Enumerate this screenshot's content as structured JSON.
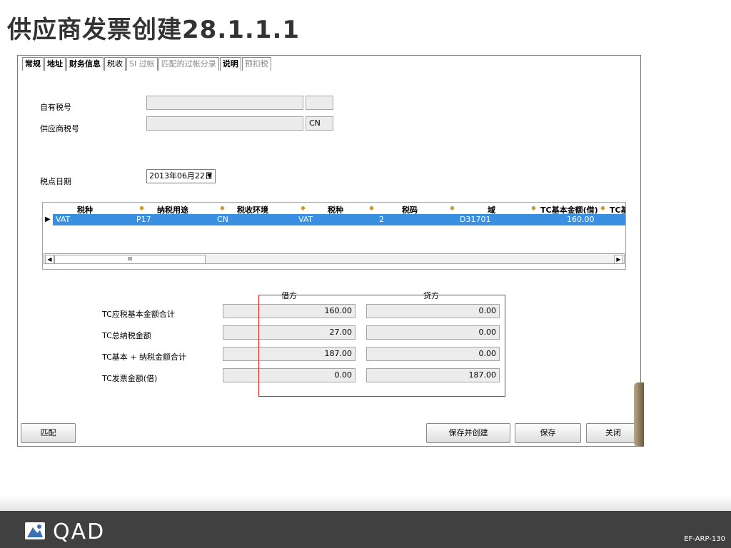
{
  "slide": {
    "title": "供应商发票创建28.1.1.1",
    "code": "EF-ARP-130",
    "logo_text": "QAD"
  },
  "tabs": [
    {
      "label": "常规",
      "style": "bold"
    },
    {
      "label": "地址",
      "style": "bold"
    },
    {
      "label": "财务信息",
      "style": "bold"
    },
    {
      "label": "税收",
      "style": "active"
    },
    {
      "label": "SI 过帐",
      "style": "dim"
    },
    {
      "label": "匹配的过帐分录",
      "style": "dim"
    },
    {
      "label": "说明",
      "style": "bold"
    },
    {
      "label": "预扣税",
      "style": "dim"
    }
  ],
  "form": {
    "own_tax_no_label": "自有税号",
    "own_tax_no_value": "",
    "own_tax_country": "",
    "supplier_tax_no_label": "供应商税号",
    "supplier_tax_no_value": "",
    "supplier_tax_country": "CN",
    "tax_date_label": "税点日期",
    "tax_date_value": "2013年06月22日"
  },
  "grid": {
    "columns": [
      "税种",
      "纳税用途",
      "税收环境",
      "税种",
      "税码",
      "域",
      "TC基本金额(借)",
      "TC基"
    ],
    "rows": [
      [
        "VAT",
        "P17",
        "CN",
        "VAT",
        "2",
        "D31701",
        "160.00",
        ""
      ]
    ],
    "scroll_thumb": "III"
  },
  "totals": {
    "debit_header": "借方",
    "credit_header": "贷方",
    "rows": [
      {
        "label": "TC应税基本金额合计",
        "debit": "160.00",
        "credit": "0.00"
      },
      {
        "label": "TC总纳税金额",
        "debit": "27.00",
        "credit": "0.00"
      },
      {
        "label": "TC基本 + 纳税金额合计",
        "debit": "187.00",
        "credit": "0.00"
      },
      {
        "label": "TC发票金额(借)",
        "debit": "0.00",
        "credit": "187.00"
      }
    ]
  },
  "buttons": {
    "match": "匹配",
    "save_and_create": "保存并创建",
    "save": "保存",
    "close": "关闭"
  },
  "colors": {
    "selected_row": "#3a8fe0",
    "highlight_box": "#dd2222",
    "footer": "#404040",
    "sort_marker": "#c79a2a"
  }
}
